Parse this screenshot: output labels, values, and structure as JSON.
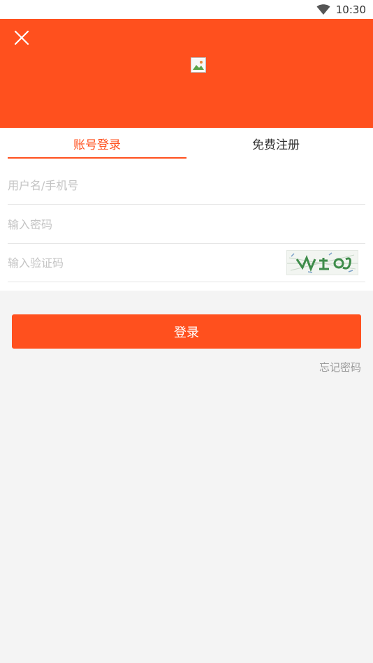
{
  "status_bar": {
    "time": "10:30",
    "icons": [
      "wifi-icon"
    ]
  },
  "header": {
    "background_color": "#ff501e",
    "close_icon": "close-icon",
    "logo": "broken-image-icon"
  },
  "tabs": [
    {
      "label": "账号登录",
      "active": true
    },
    {
      "label": "免费注册",
      "active": false
    }
  ],
  "form": {
    "username_placeholder": "用户名/手机号",
    "username_value": "",
    "password_placeholder": "输入密码",
    "password_value": "",
    "captcha_placeholder": "输入验证码",
    "captcha_value": "",
    "captcha_image": "captcha-image"
  },
  "actions": {
    "login_label": "登录",
    "forgot_label": "忘记密码"
  },
  "colors": {
    "accent": "#ff501e",
    "page_background": "#f4f4f4"
  }
}
